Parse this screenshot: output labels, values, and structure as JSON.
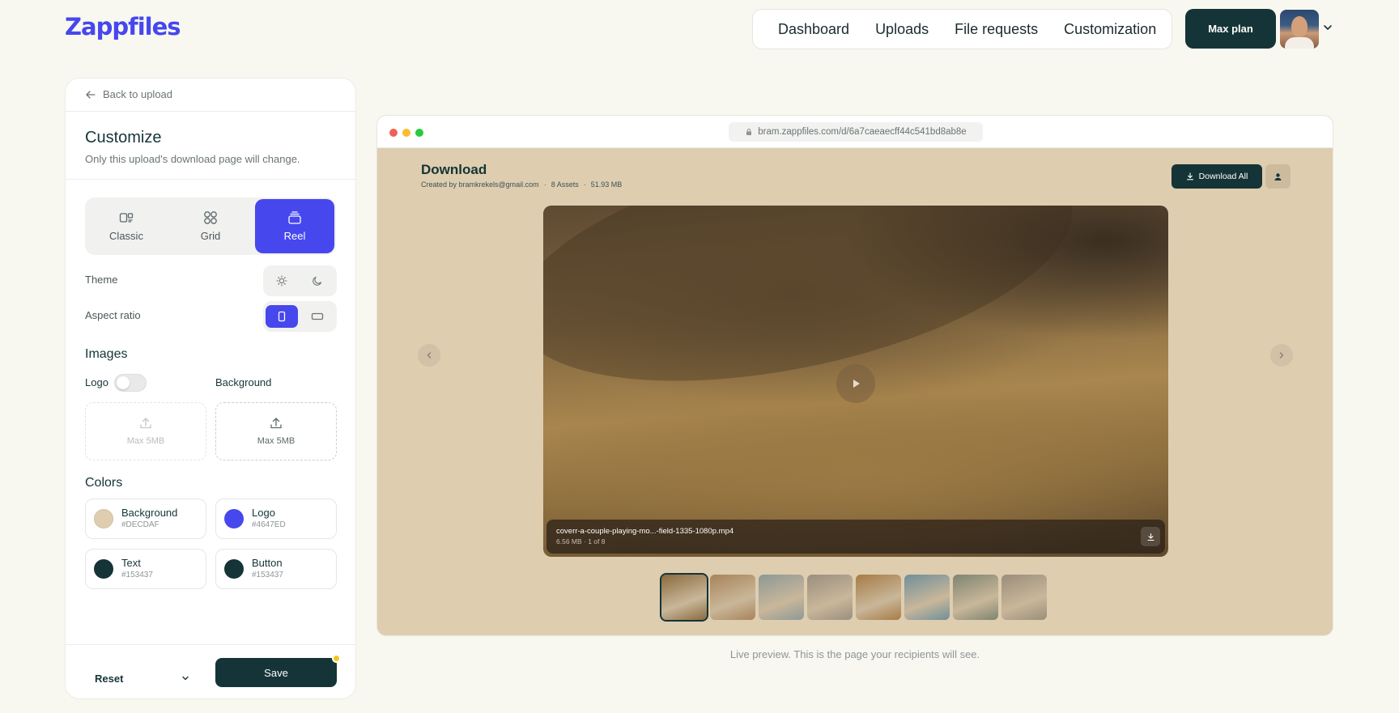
{
  "brand": {
    "name": "Zappfiles"
  },
  "nav": {
    "items": [
      {
        "label": "Dashboard"
      },
      {
        "label": "Uploads"
      },
      {
        "label": "File requests"
      },
      {
        "label": "Customization"
      }
    ]
  },
  "plan": {
    "label": "Max plan"
  },
  "panel": {
    "back_label": "Back to upload",
    "title": "Customize",
    "subtitle": "Only this upload's download page will change.",
    "layouts": [
      {
        "label": "Classic"
      },
      {
        "label": "Grid"
      },
      {
        "label": "Reel",
        "selected": true
      }
    ],
    "theme_label": "Theme",
    "aspect_label": "Aspect ratio",
    "aspect_selected": "portrait",
    "images_title": "Images",
    "logo_label": "Logo",
    "logo_enabled": false,
    "background_label": "Background",
    "dropzone_logo": "Max 5MB",
    "dropzone_background": "Max 5MB",
    "colors_title": "Colors",
    "colors": [
      {
        "name": "Background",
        "hex": "#DECDAF"
      },
      {
        "name": "Logo",
        "hex": "#4647ED"
      },
      {
        "name": "Text",
        "hex": "#153437"
      },
      {
        "name": "Button",
        "hex": "#153437"
      }
    ],
    "reset_label": "Reset",
    "save_label": "Save"
  },
  "preview": {
    "url": "bram.zappfiles.com/d/6a7caeaecff44c541bd8ab8e",
    "title": "Download",
    "meta": {
      "created_by": "Created by bramkrekels@gmail.com",
      "assets": "8 Assets",
      "size": "51.93 MB"
    },
    "download_all_label": "Download All",
    "file": {
      "name": "coverr-a-couple-playing-mo...-field-1335-1080p.mp4",
      "size": "6.56 MB",
      "position": "1 of 8"
    },
    "thumbnails": [
      {
        "color": "#8a6a3e",
        "selected": true
      },
      {
        "color": "#a8835a"
      },
      {
        "color": "#8e9896"
      },
      {
        "color": "#9a8e7e"
      },
      {
        "color": "#a67b45"
      },
      {
        "color": "#6f8f9a"
      },
      {
        "color": "#7e8470"
      },
      {
        "color": "#9a8d7a"
      }
    ]
  },
  "caption": "Live preview. This is the page your recipients will see."
}
